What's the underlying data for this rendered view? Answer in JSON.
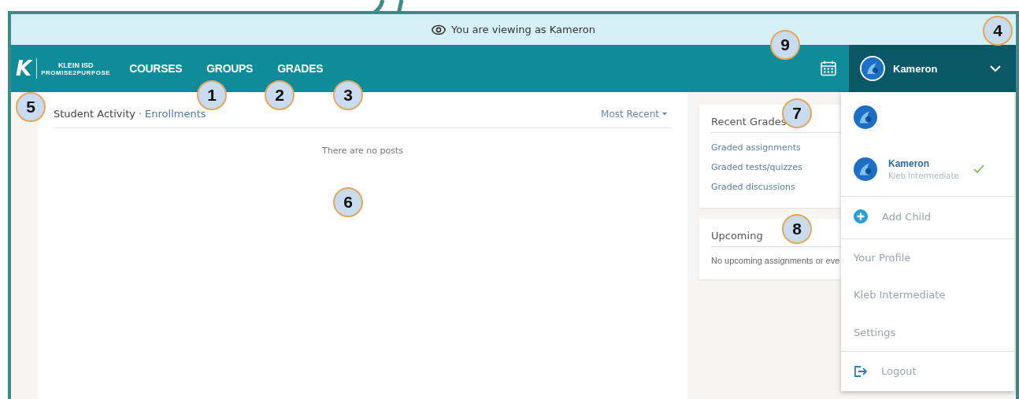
{
  "banner": {
    "text": "You are viewing as Kameron"
  },
  "navbar": {
    "logo": {
      "mark": "K",
      "title": "KLEIN ISD",
      "tagline": "PROMISE2PURPOSE"
    },
    "links": [
      {
        "label": "COURSES"
      },
      {
        "label": "GROUPS"
      },
      {
        "label": "GRADES"
      }
    ],
    "user": {
      "name": "Kameron",
      "expanded": true
    }
  },
  "activity": {
    "title": "Student Activity",
    "separator": "·",
    "link": "Enrollments",
    "sort": "Most Recent",
    "empty": "There are no posts"
  },
  "recent_grades": {
    "title": "Recent Grades",
    "links": [
      "Graded assignments",
      "Graded tests/quizzes",
      "Graded discussions"
    ]
  },
  "upcoming": {
    "title": "Upcoming",
    "empty": "No upcoming assignments or eve"
  },
  "user_menu": [
    {
      "kind": "account",
      "selected": false
    },
    {
      "kind": "account",
      "name": "Kameron",
      "school": "Kleb Intermediate",
      "selected": true
    },
    {
      "kind": "add",
      "label": "Add Child"
    },
    {
      "kind": "link",
      "label": "Your Profile"
    },
    {
      "kind": "link",
      "label": "Kleb Intermediate"
    },
    {
      "kind": "link",
      "label": "Settings"
    },
    {
      "kind": "logout",
      "label": "Logout"
    }
  ],
  "callouts": [
    {
      "label": "1"
    },
    {
      "label": "2"
    },
    {
      "label": "3"
    },
    {
      "label": "4"
    },
    {
      "label": "5"
    },
    {
      "label": "6"
    },
    {
      "label": "7"
    },
    {
      "label": "8"
    },
    {
      "label": "9"
    }
  ]
}
